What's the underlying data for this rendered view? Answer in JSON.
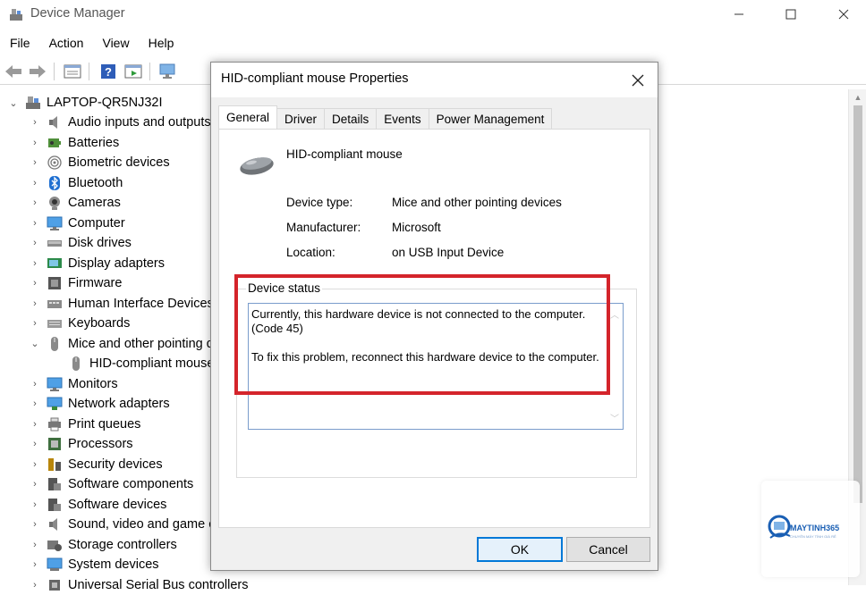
{
  "window": {
    "title": "Device Manager"
  },
  "menu": [
    "File",
    "Action",
    "View",
    "Help"
  ],
  "tree": {
    "root": "LAPTOP-QR5NJ32I",
    "items": [
      {
        "label": "Audio inputs and outputs",
        "icon": "speaker-icon"
      },
      {
        "label": "Batteries",
        "icon": "battery-icon"
      },
      {
        "label": "Biometric devices",
        "icon": "fingerprint-icon"
      },
      {
        "label": "Bluetooth",
        "icon": "bluetooth-icon"
      },
      {
        "label": "Cameras",
        "icon": "camera-icon"
      },
      {
        "label": "Computer",
        "icon": "monitor-icon"
      },
      {
        "label": "Disk drives",
        "icon": "disk-icon"
      },
      {
        "label": "Display adapters",
        "icon": "display-adapter-icon"
      },
      {
        "label": "Firmware",
        "icon": "firmware-icon"
      },
      {
        "label": "Human Interface Devices",
        "icon": "hid-icon"
      },
      {
        "label": "Keyboards",
        "icon": "keyboard-icon"
      },
      {
        "label": "Mice and other pointing devices",
        "icon": "mouse-icon",
        "expanded": true
      },
      {
        "label": "HID-compliant mouse",
        "icon": "mouse-icon",
        "child": true
      },
      {
        "label": "Monitors",
        "icon": "monitor-icon"
      },
      {
        "label": "Network adapters",
        "icon": "network-icon"
      },
      {
        "label": "Print queues",
        "icon": "printer-icon"
      },
      {
        "label": "Processors",
        "icon": "processor-icon"
      },
      {
        "label": "Security devices",
        "icon": "security-icon"
      },
      {
        "label": "Software components",
        "icon": "software-icon"
      },
      {
        "label": "Software devices",
        "icon": "software-icon"
      },
      {
        "label": "Sound, video and game controllers",
        "icon": "speaker-icon"
      },
      {
        "label": "Storage controllers",
        "icon": "storage-icon"
      },
      {
        "label": "System devices",
        "icon": "system-icon"
      },
      {
        "label": "Universal Serial Bus controllers",
        "icon": "usb-icon"
      }
    ]
  },
  "dialog": {
    "title": "HID-compliant mouse Properties",
    "tabs": [
      "General",
      "Driver",
      "Details",
      "Events",
      "Power Management"
    ],
    "active_tab": "General",
    "device_name": "HID-compliant mouse",
    "props": {
      "type_label": "Device type:",
      "type_value": "Mice and other pointing devices",
      "mfr_label": "Manufacturer:",
      "mfr_value": "Microsoft",
      "loc_label": "Location:",
      "loc_value": "on USB Input Device"
    },
    "status_title": "Device status",
    "status_line1": "Currently, this hardware device is not connected to the computer. (Code 45)",
    "status_line2": "To fix this problem, reconnect this hardware device to the computer.",
    "ok": "OK",
    "cancel": "Cancel"
  },
  "watermark": {
    "text": "MAYTINH365",
    "sub": "CHUYÊN MÁY TÍNH GIÁ RẺ"
  },
  "colors": {
    "highlight": "#d4242b",
    "accent": "#0078d7"
  }
}
